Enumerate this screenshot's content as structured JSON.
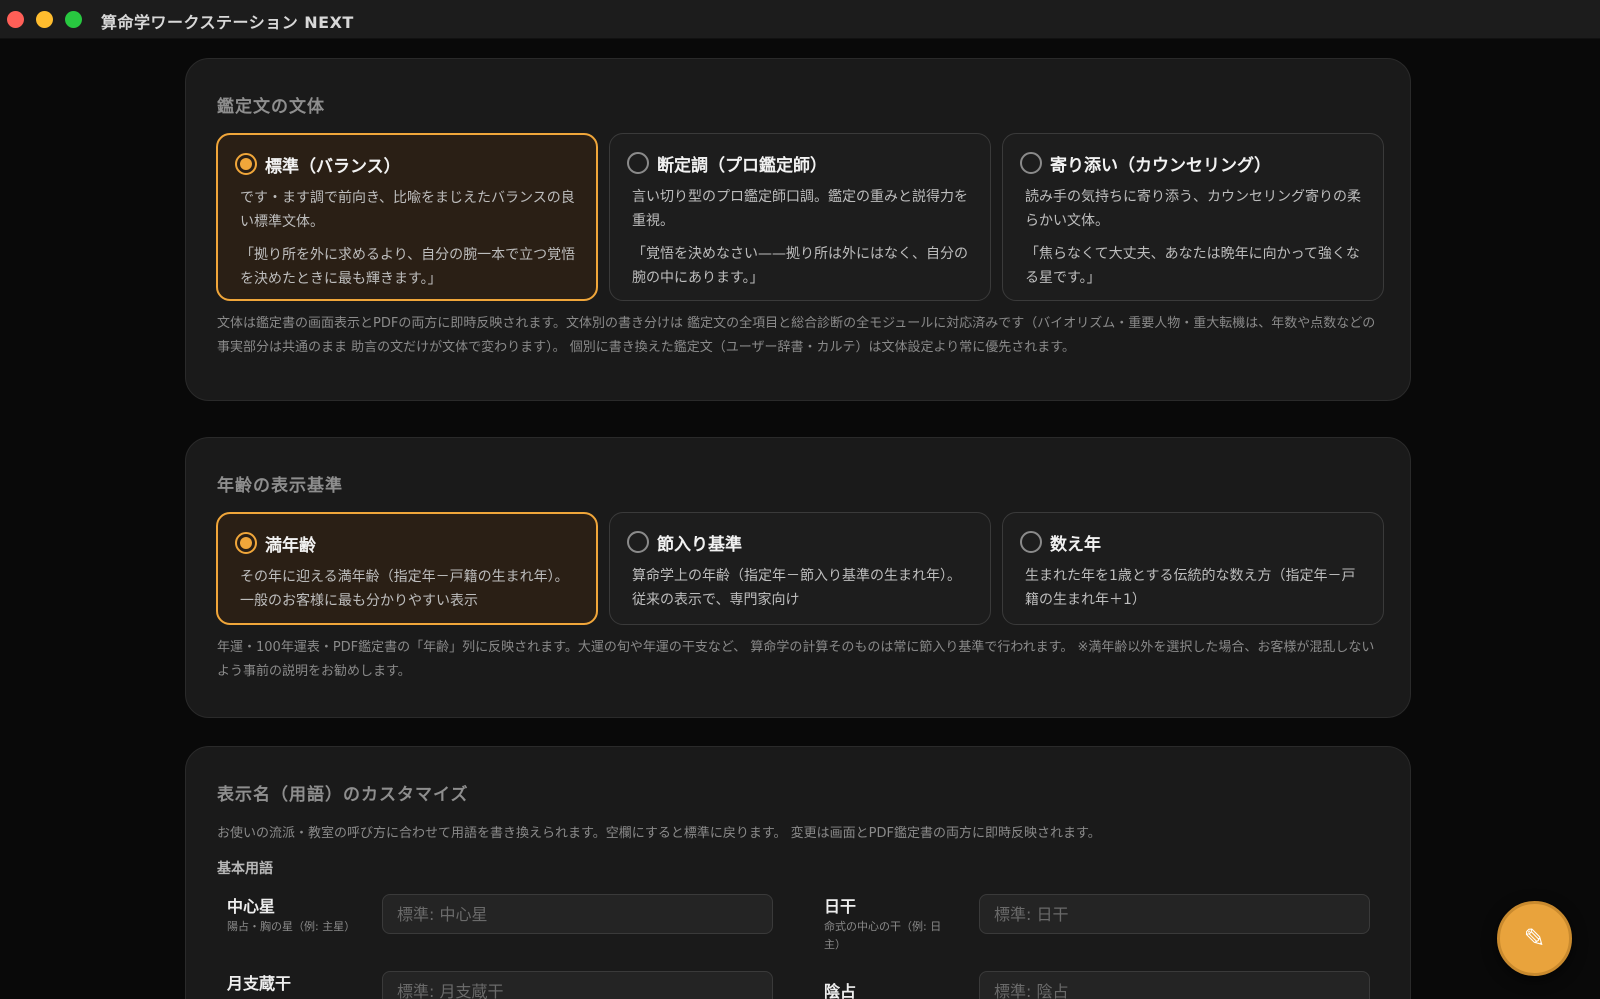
{
  "window": {
    "title": "算命学ワークステーション NEXT"
  },
  "style_section": {
    "title": "鑑定文の文体",
    "options": [
      {
        "title": "標準（バランス）",
        "desc": "です・ます調で前向き、比喩をまじえたバランスの良い標準文体。",
        "quote": "「拠り所を外に求めるより、自分の腕一本で立つ覚悟を決めたときに最も輝きます。」",
        "selected": true
      },
      {
        "title": "断定調（プロ鑑定師）",
        "desc": "言い切り型のプロ鑑定師口調。鑑定の重みと説得力を重視。",
        "quote": "「覚悟を決めなさい——拠り所は外にはなく、自分の腕の中にあります。」",
        "selected": false
      },
      {
        "title": "寄り添い（カウンセリング）",
        "desc": "読み手の気持ちに寄り添う、カウンセリング寄りの柔らかい文体。",
        "quote": "「焦らなくて大丈夫、あなたは晩年に向かって強くなる星です。」",
        "selected": false
      }
    ],
    "note": "文体は鑑定書の画面表示とPDFの両方に即時反映されます。文体別の書き分けは 鑑定文の全項目と総合診断の全モジュールに対応済みです（バイオリズム・重要人物・重大転機は、年数や点数などの事実部分は共通のまま 助言の文だけが文体で変わります）。 個別に書き換えた鑑定文（ユーザー辞書・カルテ）は文体設定より常に優先されます。"
  },
  "age_section": {
    "title": "年齢の表示基準",
    "options": [
      {
        "title": "満年齢",
        "desc": "その年に迎える満年齢（指定年－戸籍の生まれ年）。一般のお客様に最も分かりやすい表示",
        "selected": true
      },
      {
        "title": "節入り基準",
        "desc": "算命学上の年齢（指定年－節入り基準の生まれ年）。従来の表示で、専門家向け",
        "selected": false
      },
      {
        "title": "数え年",
        "desc": "生まれた年を1歳とする伝統的な数え方（指定年－戸籍の生まれ年＋1）",
        "selected": false
      }
    ],
    "note": "年運・100年運表・PDF鑑定書の「年齢」列に反映されます。大運の旬や年運の干支など、 算命学の計算そのものは常に節入り基準で行われます。 ※満年齢以外を選択した場合、お客様が混乱しないよう事前の説明をお勧めします。"
  },
  "terms_section": {
    "title": "表示名（用語）のカスタマイズ",
    "desc": "お使いの流派・教室の呼び方に合わせて用語を書き換えられます。空欄にすると標準に戻ります。 変更は画面とPDF鑑定書の両方に即時反映されます。",
    "group_label": "基本用語",
    "fields": [
      {
        "label": "中心星",
        "hint": "陽占・胸の星（例: 主星）",
        "placeholder": "標準: 中心星",
        "value": ""
      },
      {
        "label": "日干",
        "hint": "命式の中心の干（例: 日主）",
        "placeholder": "標準: 日干",
        "value": ""
      },
      {
        "label": "月支蔵干",
        "hint": "",
        "placeholder": "標準: 月支蔵干",
        "value": ""
      },
      {
        "label": "陰占",
        "hint": "",
        "placeholder": "標準: 陰占",
        "value": ""
      }
    ]
  },
  "fab": {
    "icon": "pencil-icon",
    "glyph": "✎"
  },
  "colors": {
    "accent": "#f0a63a",
    "background": "#090909",
    "panel": "#1a1a1a"
  }
}
